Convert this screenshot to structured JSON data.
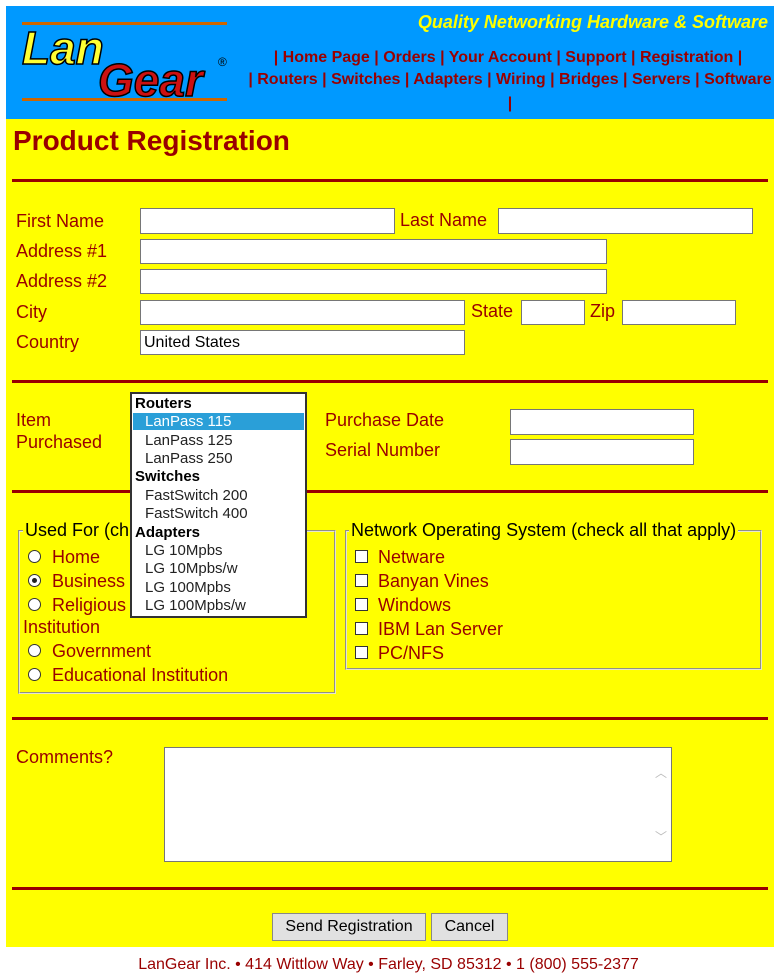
{
  "header": {
    "logo_text": "LanGear",
    "logo_lan": "Lan",
    "logo_gear": "Gear",
    "logo_mark": "®",
    "tagline": "Quality Networking Hardware & Software",
    "nav_primary": [
      "Home Page",
      "Orders",
      "Your Account",
      "Support",
      "Registration"
    ],
    "nav_secondary": [
      "Routers",
      "Switches",
      "Adapters",
      "Wiring",
      "Bridges",
      "Servers",
      "Software"
    ],
    "separator": "|"
  },
  "page_title": "Product Registration",
  "address": {
    "first_name_label": "First Name",
    "last_name_label": "Last Name",
    "address1_label": "Address #1",
    "address2_label": "Address #2",
    "city_label": "City",
    "state_label": "State",
    "zip_label": "Zip",
    "country_label": "Country",
    "first_name_value": "",
    "last_name_value": "",
    "address1_value": "",
    "address2_value": "",
    "city_value": "",
    "state_value": "",
    "zip_value": "",
    "country_value": "United States"
  },
  "purchase": {
    "item_label_1": "Item",
    "item_label_2": "Purchased",
    "purchase_date_label": "Purchase Date",
    "serial_number_label": "Serial Number",
    "purchase_date_value": "",
    "serial_number_value": "",
    "listbox": {
      "groups": [
        {
          "name": "Routers",
          "items": [
            "LanPass 115",
            "LanPass 125",
            "LanPass 250"
          ]
        },
        {
          "name": "Switches",
          "items": [
            "FastSwitch 200",
            "FastSwitch 400"
          ]
        },
        {
          "name": "Adapters",
          "items": [
            "LG 10Mpbs",
            "LG 10Mpbs/w",
            "LG 100Mpbs",
            "LG 100Mpbs/w"
          ]
        }
      ],
      "selected": "LanPass 115",
      "selected_color": "#2a9fd8"
    }
  },
  "used_for": {
    "legend": "Used For (ch",
    "options": [
      "Home",
      "Business",
      "Religious",
      "Institution",
      "Government",
      "Educational Institution"
    ],
    "selected": "Business"
  },
  "nos": {
    "legend": "Network Operating System (check all that apply)",
    "options": [
      "Netware",
      "Banyan Vines",
      "Windows",
      "IBM Lan Server",
      "PC/NFS"
    ]
  },
  "comments": {
    "label": "Comments?",
    "value": ""
  },
  "buttons": {
    "send": "Send Registration",
    "cancel": "Cancel"
  },
  "footer": "LanGear Inc. • 414 Wittlow Way • Farley, SD 85312 • 1 (800) 555-2377",
  "colors": {
    "header_bg": "#0099ff",
    "panel_bg": "#ffff00",
    "accent": "#990000",
    "tagline": "#ffff00"
  }
}
